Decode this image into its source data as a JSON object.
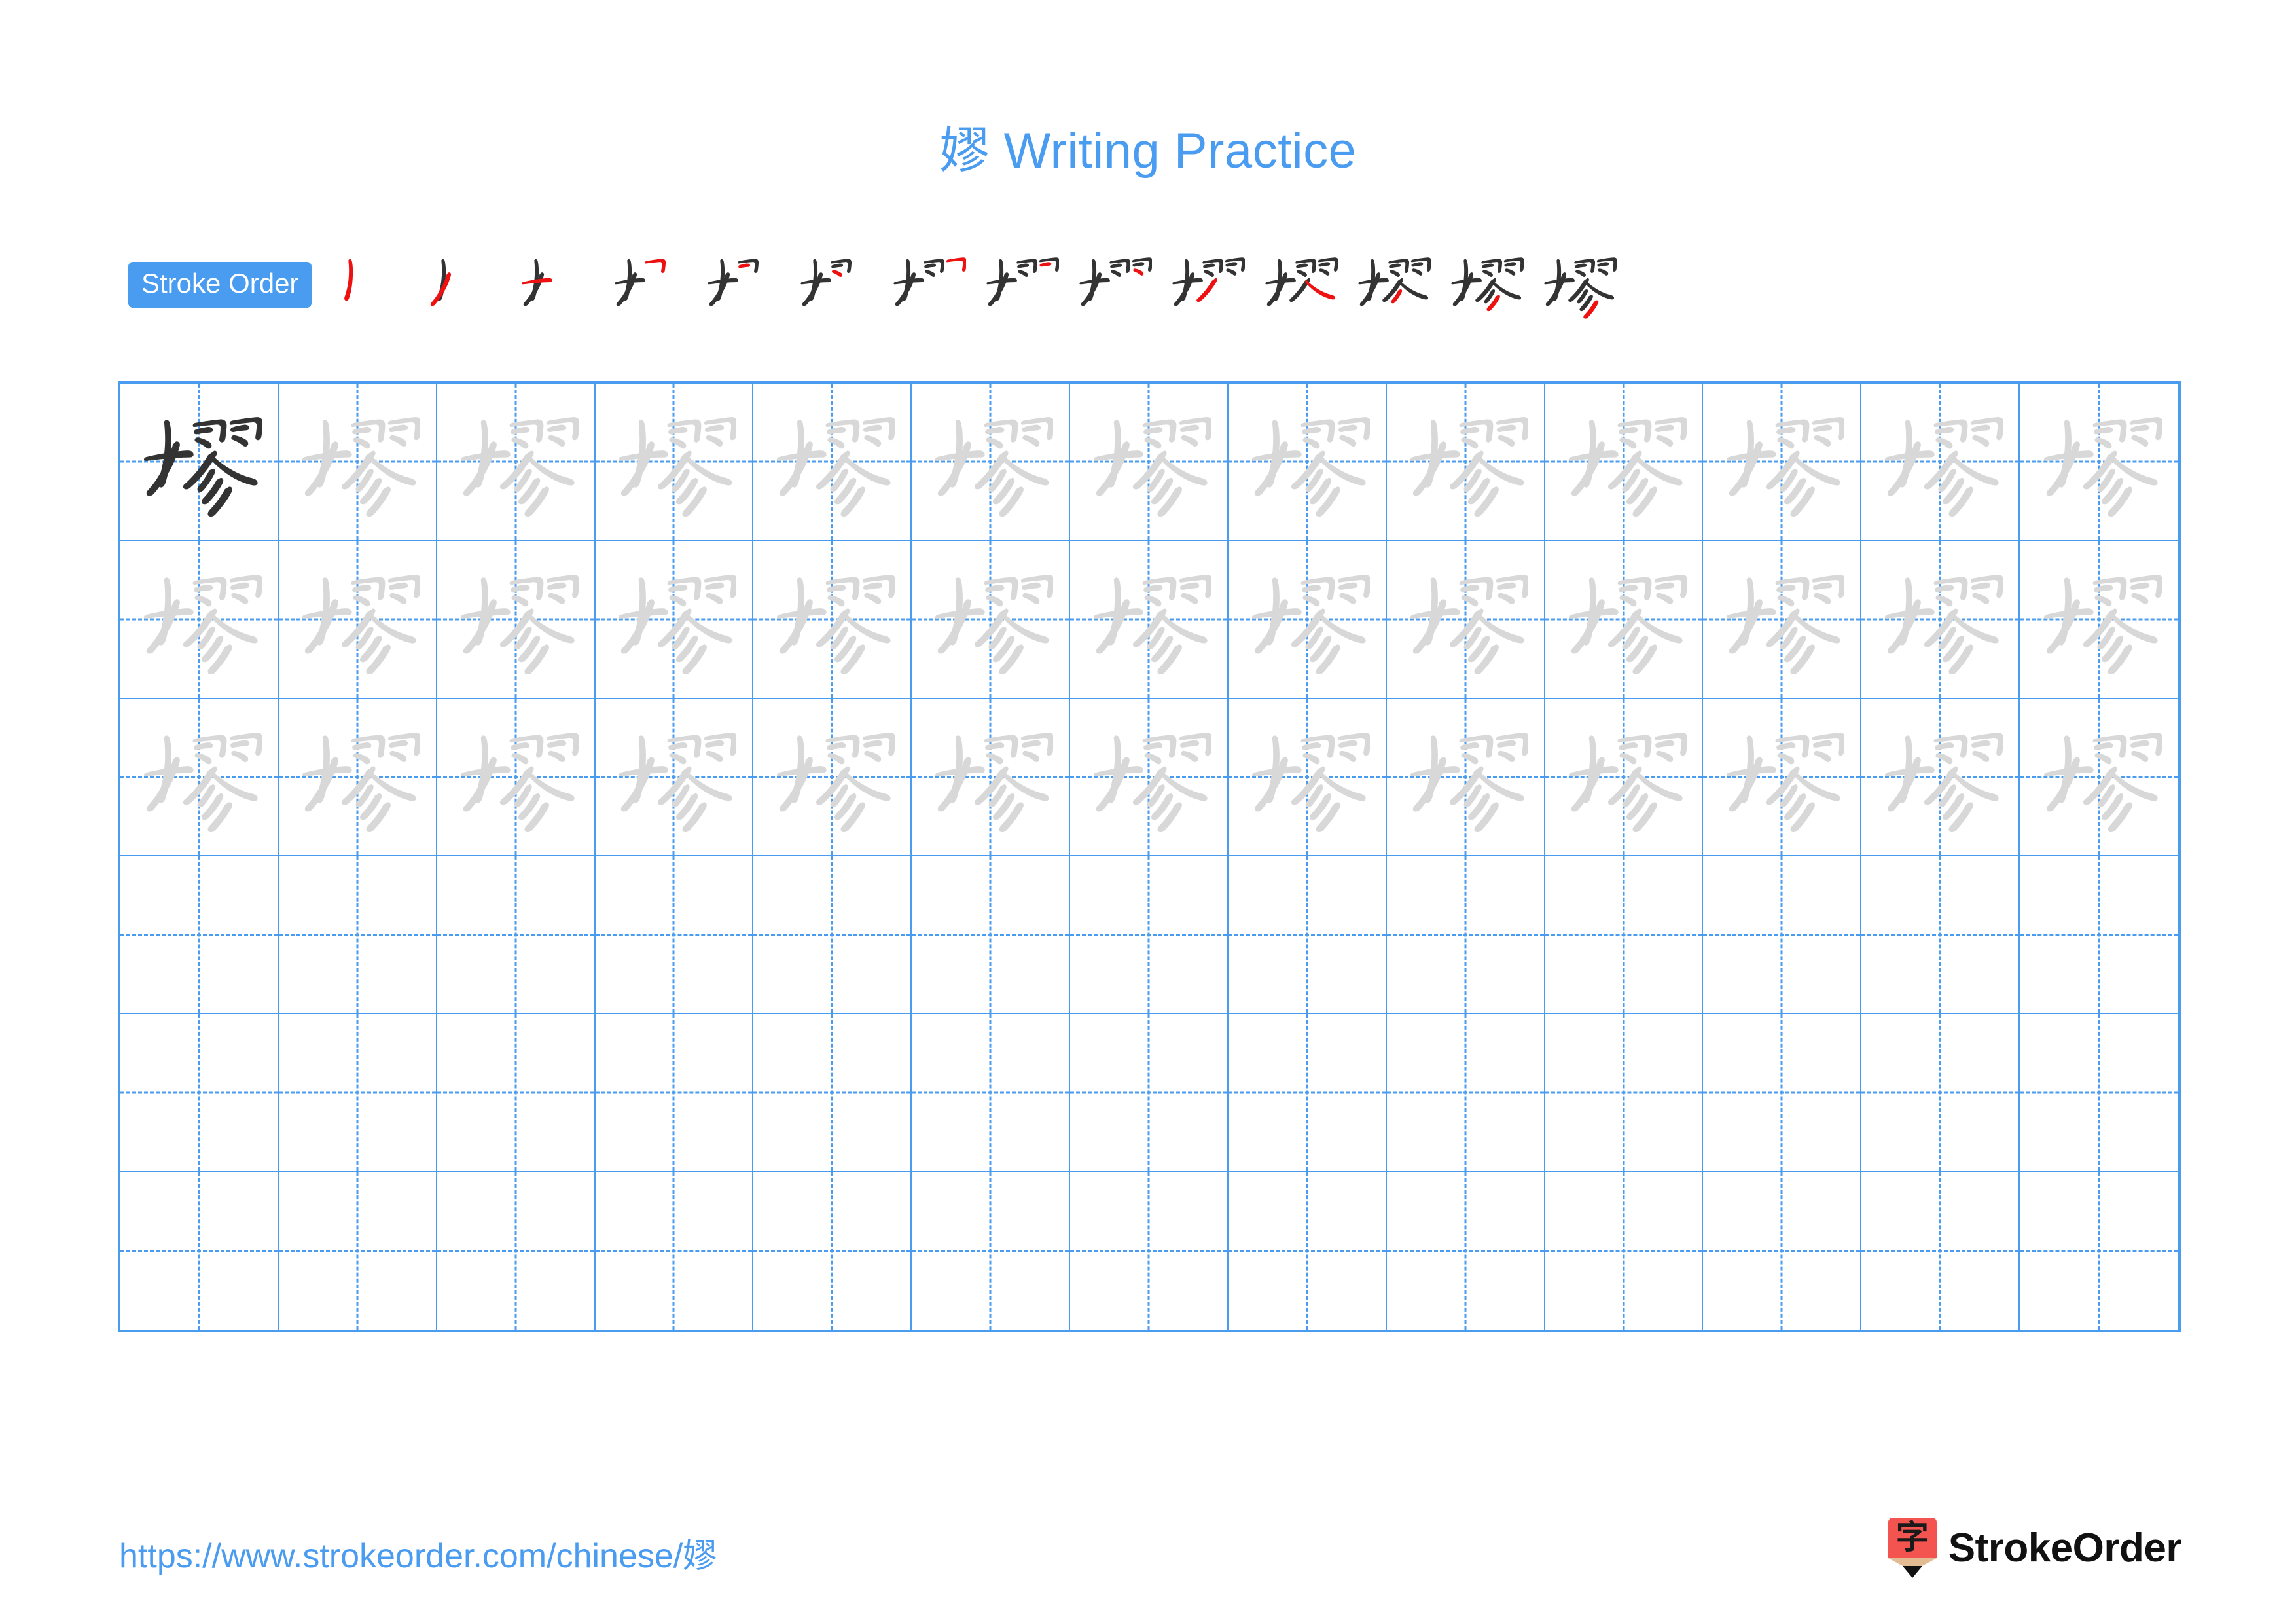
{
  "character": "嫪",
  "title": {
    "character": "嫪",
    "suffix": " Writing Practice",
    "full": "嫪 Writing Practice",
    "color": "#4a9cf0"
  },
  "stroke_order": {
    "badge_label": "Stroke Order",
    "badge_bg": "#4a9cf0",
    "badge_text_color": "#ffffff",
    "total_strokes": 14,
    "existing_stroke_color": "#333333",
    "new_stroke_color": "#ee1111",
    "steps": [
      {
        "index": 1,
        "strokes_shown": 1
      },
      {
        "index": 2,
        "strokes_shown": 2
      },
      {
        "index": 3,
        "strokes_shown": 3
      },
      {
        "index": 4,
        "strokes_shown": 4
      },
      {
        "index": 5,
        "strokes_shown": 5
      },
      {
        "index": 6,
        "strokes_shown": 6
      },
      {
        "index": 7,
        "strokes_shown": 7
      },
      {
        "index": 8,
        "strokes_shown": 8
      },
      {
        "index": 9,
        "strokes_shown": 9
      },
      {
        "index": 10,
        "strokes_shown": 10
      },
      {
        "index": 11,
        "strokes_shown": 11
      },
      {
        "index": 12,
        "strokes_shown": 12
      },
      {
        "index": 13,
        "strokes_shown": 13
      },
      {
        "index": 14,
        "strokes_shown": 14
      }
    ]
  },
  "practice_grid": {
    "columns": 13,
    "rows": 6,
    "grid_line_color": "#4a9cf0",
    "guide_line_color": "#4a9cf0",
    "model_char_color": "#333333",
    "trace_char_color": "#d8d8d8",
    "row_fill": [
      {
        "row": 1,
        "mode": "model-then-trace",
        "filled_cells": 13
      },
      {
        "row": 2,
        "mode": "trace",
        "filled_cells": 13
      },
      {
        "row": 3,
        "mode": "trace",
        "filled_cells": 13
      },
      {
        "row": 4,
        "mode": "blank",
        "filled_cells": 0
      },
      {
        "row": 5,
        "mode": "blank",
        "filled_cells": 0
      },
      {
        "row": 6,
        "mode": "blank",
        "filled_cells": 0
      }
    ]
  },
  "footer": {
    "url": "https://www.strokeorder.com/chinese/嫪",
    "url_color": "#4a9cf0",
    "brand_name": "StrokeOrder",
    "brand_mark_char": "字",
    "brand_mark_color": "#f4544f",
    "brand_mark_wood_color": "#e2bb93",
    "brand_mark_tip_color": "#111111"
  }
}
